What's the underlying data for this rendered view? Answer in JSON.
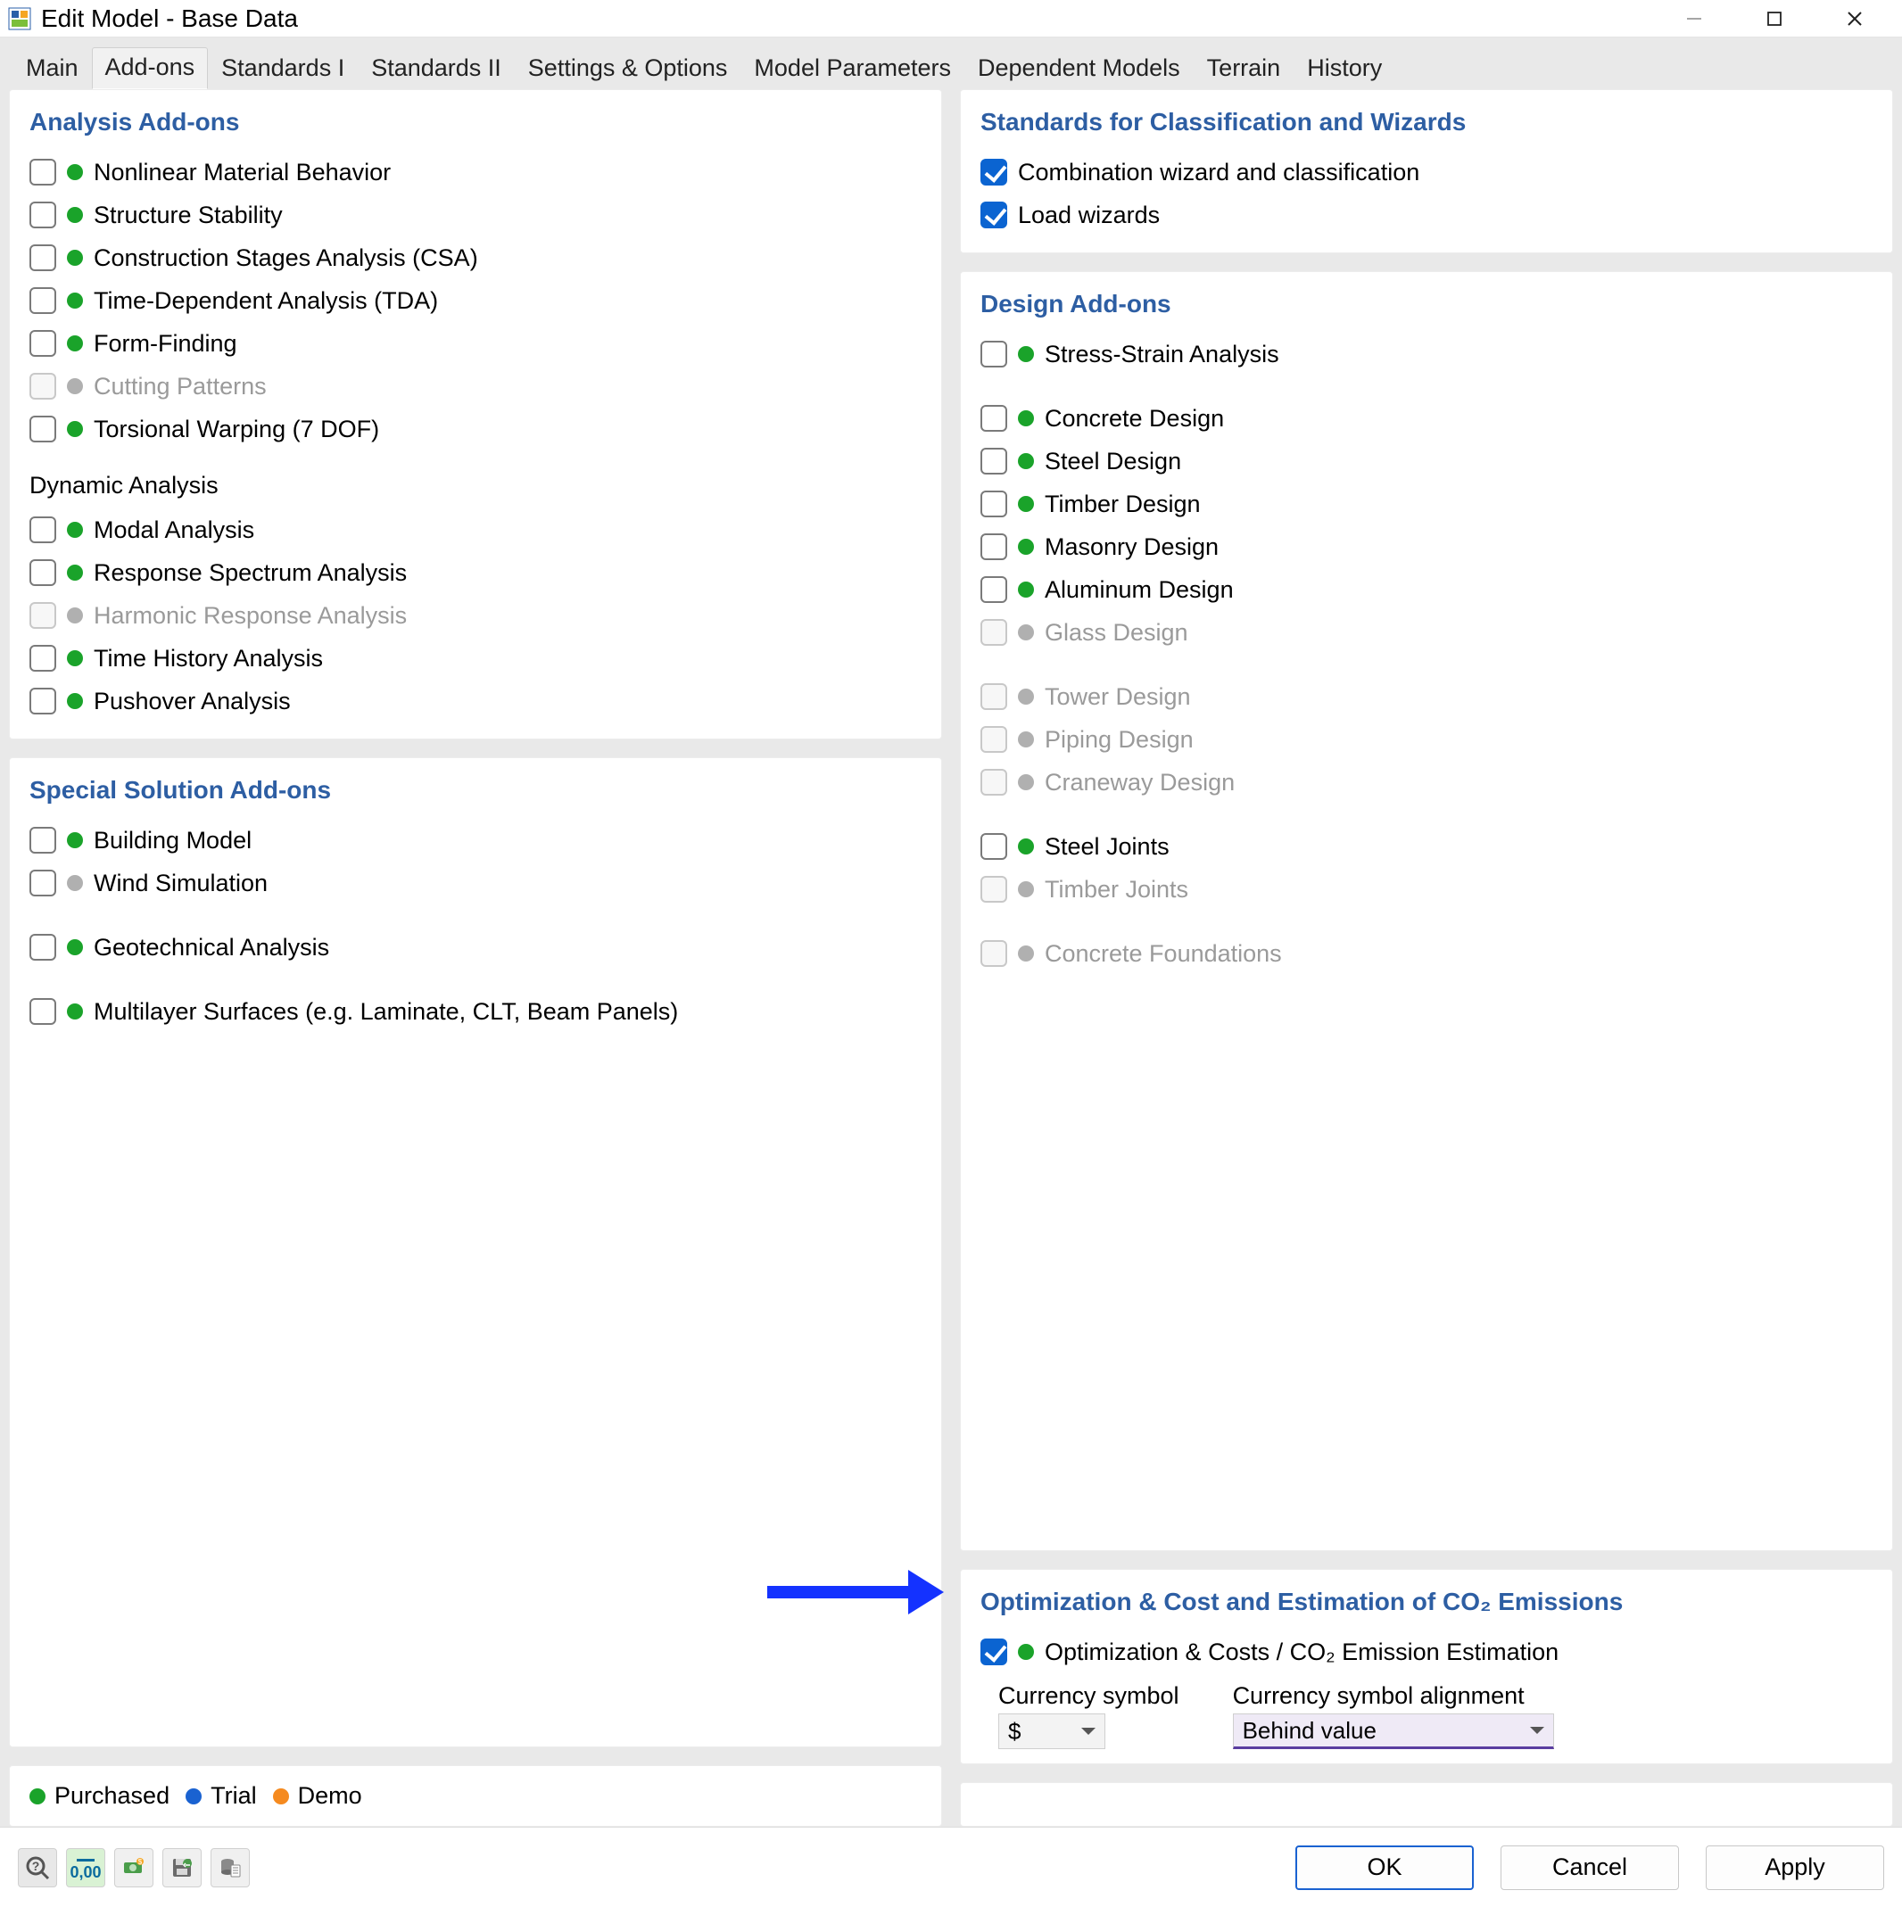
{
  "window": {
    "title": "Edit Model - Base Data"
  },
  "tabs": [
    "Main",
    "Add-ons",
    "Standards I",
    "Standards II",
    "Settings & Options",
    "Model Parameters",
    "Dependent Models",
    "Terrain",
    "History"
  ],
  "active_tab": 1,
  "left": {
    "analysis": {
      "title": "Analysis Add-ons",
      "items": [
        {
          "label": "Nonlinear Material Behavior",
          "status": "green",
          "checked": false,
          "enabled": true
        },
        {
          "label": "Structure Stability",
          "status": "green",
          "checked": false,
          "enabled": true
        },
        {
          "label": "Construction Stages Analysis (CSA)",
          "status": "green",
          "checked": false,
          "enabled": true
        },
        {
          "label": "Time-Dependent Analysis (TDA)",
          "status": "green",
          "checked": false,
          "enabled": true
        },
        {
          "label": "Form-Finding",
          "status": "green",
          "checked": false,
          "enabled": true
        },
        {
          "label": "Cutting Patterns",
          "status": "grey",
          "checked": false,
          "enabled": false
        },
        {
          "label": "Torsional Warping (7 DOF)",
          "status": "green",
          "checked": false,
          "enabled": true
        }
      ],
      "subhead": "Dynamic Analysis",
      "dyn": [
        {
          "label": "Modal Analysis",
          "status": "green",
          "checked": false,
          "enabled": true
        },
        {
          "label": "Response Spectrum Analysis",
          "status": "green",
          "checked": false,
          "enabled": true
        },
        {
          "label": "Harmonic Response Analysis",
          "status": "grey",
          "checked": false,
          "enabled": false
        },
        {
          "label": "Time History Analysis",
          "status": "green",
          "checked": false,
          "enabled": true
        },
        {
          "label": "Pushover Analysis",
          "status": "green",
          "checked": false,
          "enabled": true
        }
      ]
    },
    "special": {
      "title": "Special Solution Add-ons",
      "groups": [
        [
          {
            "label": "Building Model",
            "status": "green",
            "checked": false,
            "enabled": true
          },
          {
            "label": "Wind Simulation",
            "status": "grey",
            "checked": false,
            "enabled": true
          }
        ],
        [
          {
            "label": "Geotechnical Analysis",
            "status": "green",
            "checked": false,
            "enabled": true
          }
        ],
        [
          {
            "label": "Multilayer Surfaces (e.g. Laminate, CLT, Beam Panels)",
            "status": "green",
            "checked": false,
            "enabled": true
          }
        ]
      ]
    },
    "legend": {
      "purchased": "Purchased",
      "trial": "Trial",
      "demo": "Demo"
    }
  },
  "right": {
    "standards": {
      "title": "Standards for Classification and Wizards",
      "items": [
        {
          "label": "Combination wizard and classification",
          "checked": true
        },
        {
          "label": "Load wizards",
          "checked": true
        }
      ]
    },
    "design": {
      "title": "Design Add-ons",
      "groups": [
        [
          {
            "label": "Stress-Strain Analysis",
            "status": "green",
            "checked": false,
            "enabled": true
          }
        ],
        [
          {
            "label": "Concrete Design",
            "status": "green",
            "checked": false,
            "enabled": true
          },
          {
            "label": "Steel Design",
            "status": "green",
            "checked": false,
            "enabled": true
          },
          {
            "label": "Timber Design",
            "status": "green",
            "checked": false,
            "enabled": true
          },
          {
            "label": "Masonry Design",
            "status": "green",
            "checked": false,
            "enabled": true
          },
          {
            "label": "Aluminum Design",
            "status": "green",
            "checked": false,
            "enabled": true
          },
          {
            "label": "Glass Design",
            "status": "grey",
            "checked": false,
            "enabled": false
          }
        ],
        [
          {
            "label": "Tower Design",
            "status": "grey",
            "checked": false,
            "enabled": false
          },
          {
            "label": "Piping Design",
            "status": "grey",
            "checked": false,
            "enabled": false
          },
          {
            "label": "Craneway Design",
            "status": "grey",
            "checked": false,
            "enabled": false
          }
        ],
        [
          {
            "label": "Steel Joints",
            "status": "green",
            "checked": false,
            "enabled": true
          },
          {
            "label": "Timber Joints",
            "status": "grey",
            "checked": false,
            "enabled": false
          }
        ],
        [
          {
            "label": "Concrete Foundations",
            "status": "grey",
            "checked": false,
            "enabled": false
          }
        ]
      ]
    },
    "optim": {
      "title": "Optimization & Cost and Estimation of CO₂ Emissions",
      "item": {
        "label": "Optimization & Costs / CO₂ Emission Estimation",
        "status": "green",
        "checked": true
      },
      "currency_label": "Currency symbol",
      "currency_value": "$",
      "align_label": "Currency symbol alignment",
      "align_value": "Behind value"
    }
  },
  "buttons": {
    "ok": "OK",
    "cancel": "Cancel",
    "apply": "Apply"
  }
}
